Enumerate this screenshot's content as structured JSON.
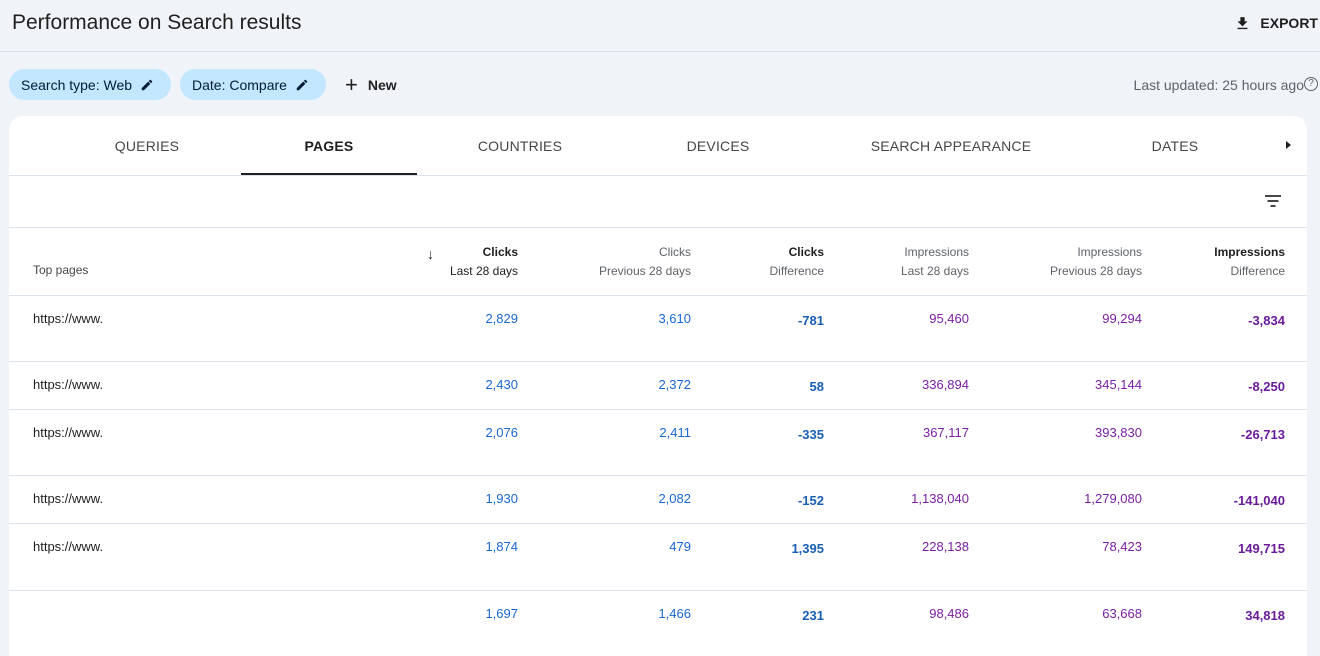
{
  "header": {
    "title": "Performance on Search results",
    "export_label": "EXPORT"
  },
  "filters": {
    "search_type": "Search type: Web",
    "date": "Date: Compare",
    "new_label": "New",
    "last_updated": "Last updated: 25 hours ago",
    "help_glyph": "?"
  },
  "tabs": [
    "QUERIES",
    "PAGES",
    "COUNTRIES",
    "DEVICES",
    "SEARCH APPEARANCE",
    "DATES"
  ],
  "active_tab": "PAGES",
  "table": {
    "row_header": "Top pages",
    "columns": [
      {
        "l1": "Clicks",
        "l2": "Last 28 days"
      },
      {
        "l1": "Clicks",
        "l2": "Previous 28 days"
      },
      {
        "l1": "Clicks",
        "l2": "Difference"
      },
      {
        "l1": "Impressions",
        "l2": "Last 28 days"
      },
      {
        "l1": "Impressions",
        "l2": "Previous 28 days"
      },
      {
        "l1": "Impressions",
        "l2": "Difference"
      }
    ],
    "rows": [
      {
        "page": "https://www.",
        "clicks_last": "2,829",
        "clicks_prev": "3,610",
        "clicks_diff": "-781",
        "impr_last": "95,460",
        "impr_prev": "99,294",
        "impr_diff": "-3,834"
      },
      {
        "page": "https://www.",
        "clicks_last": "2,430",
        "clicks_prev": "2,372",
        "clicks_diff": "58",
        "impr_last": "336,894",
        "impr_prev": "345,144",
        "impr_diff": "-8,250"
      },
      {
        "page": "https://www.",
        "clicks_last": "2,076",
        "clicks_prev": "2,411",
        "clicks_diff": "-335",
        "impr_last": "367,117",
        "impr_prev": "393,830",
        "impr_diff": "-26,713"
      },
      {
        "page": "https://www.",
        "clicks_last": "1,930",
        "clicks_prev": "2,082",
        "clicks_diff": "-152",
        "impr_last": "1,138,040",
        "impr_prev": "1,279,080",
        "impr_diff": "-141,040"
      },
      {
        "page": "https://www.",
        "clicks_last": "1,874",
        "clicks_prev": "479",
        "clicks_diff": "1,395",
        "impr_last": "228,138",
        "impr_prev": "78,423",
        "impr_diff": "149,715"
      },
      {
        "page": "",
        "clicks_last": "1,697",
        "clicks_prev": "1,466",
        "clicks_diff": "231",
        "impr_last": "98,486",
        "impr_prev": "63,668",
        "impr_diff": "34,818"
      }
    ]
  },
  "colors": {
    "clicks": "#1967d2",
    "impressions": "#7b1fa2",
    "chip_bg": "#c2e7ff",
    "page_bg": "#f0f4f9"
  }
}
